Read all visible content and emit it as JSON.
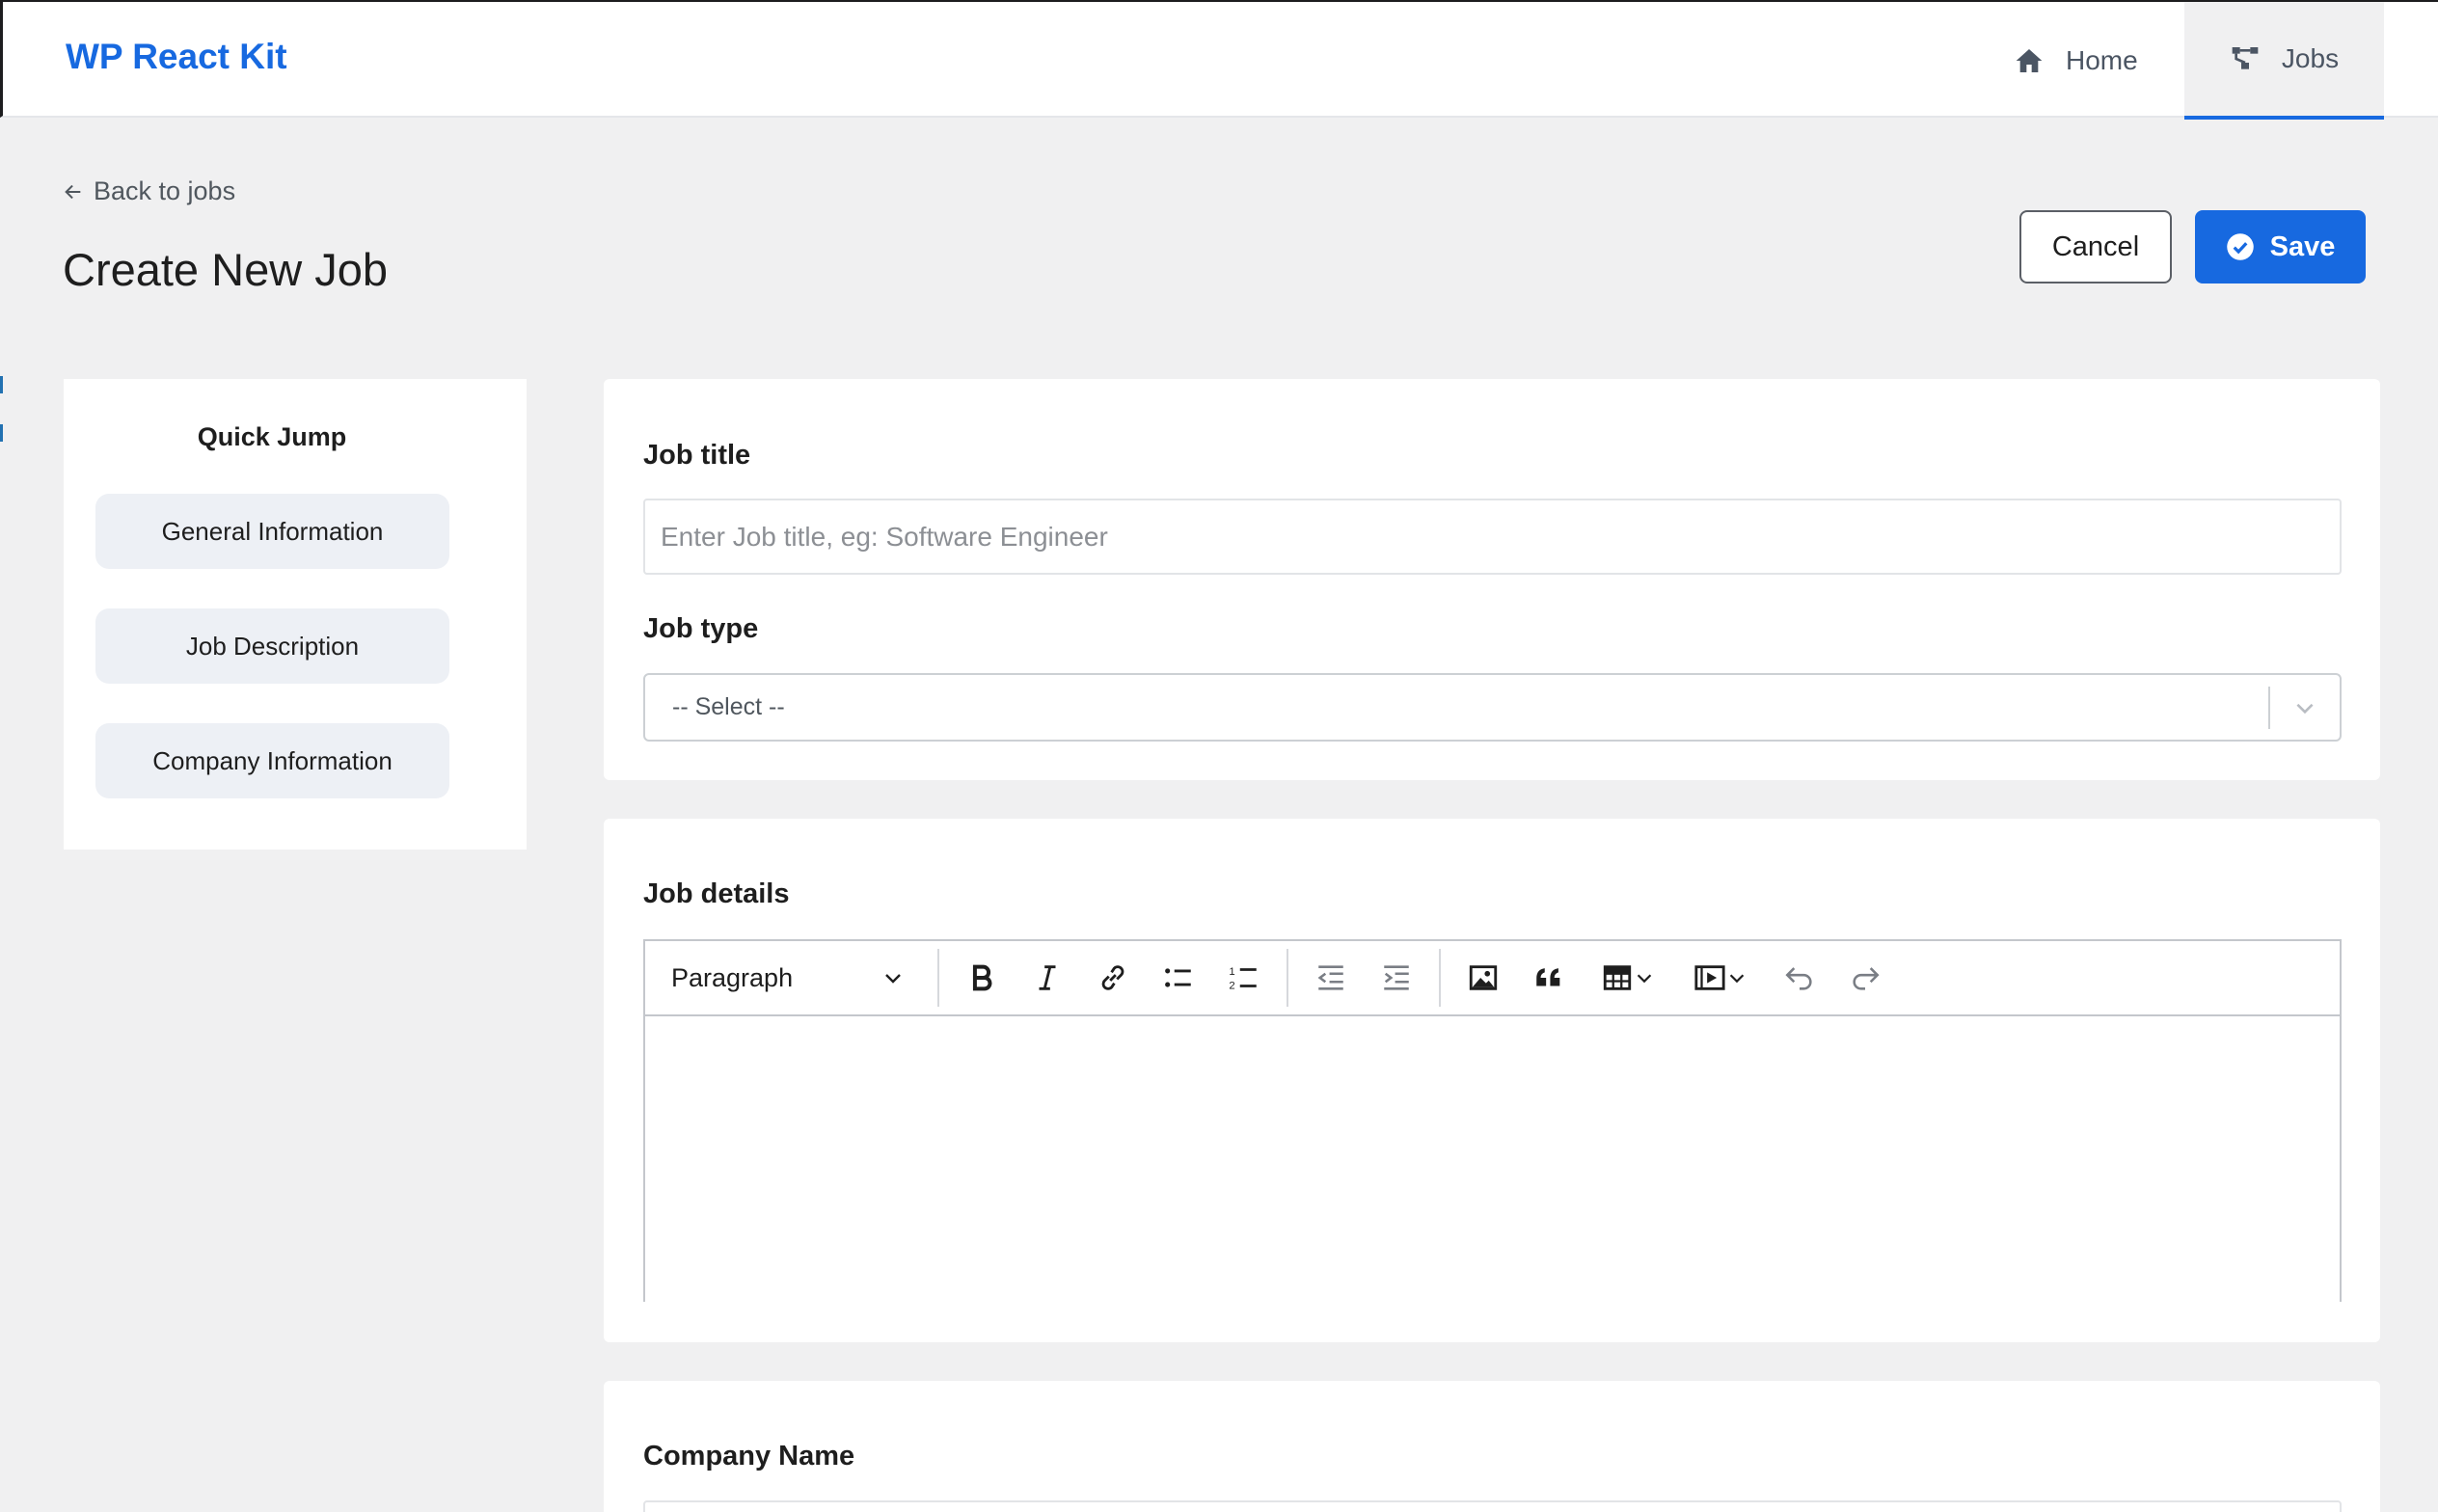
{
  "app": {
    "brand": "WP React Kit"
  },
  "nav": {
    "items": [
      {
        "label": "Home",
        "icon": "home-icon",
        "active": false
      },
      {
        "label": "Jobs",
        "icon": "jobs-icon",
        "active": true
      }
    ]
  },
  "header": {
    "back_label": "Back to jobs",
    "title": "Create New Job",
    "cancel_label": "Cancel",
    "save_label": "Save"
  },
  "quick_jump": {
    "title": "Quick Jump",
    "items": [
      "General Information",
      "Job Description",
      "Company Information"
    ]
  },
  "form": {
    "job_title": {
      "label": "Job title",
      "value": "",
      "placeholder": "Enter Job title, eg: Software Engineer"
    },
    "job_type": {
      "label": "Job type",
      "selected": "-- Select --"
    },
    "job_details": {
      "label": "Job details",
      "block_format": "Paragraph",
      "toolbar_icons": [
        "bold-icon",
        "italic-icon",
        "link-icon",
        "bulleted-list-icon",
        "numbered-list-icon",
        "outdent-icon",
        "indent-icon",
        "image-icon",
        "quote-icon",
        "table-icon",
        "media-icon",
        "undo-icon",
        "redo-icon"
      ],
      "content": ""
    },
    "company_name": {
      "label": "Company Name"
    }
  },
  "colors": {
    "accent": "#1769e0",
    "page_bg": "#f0f0f1",
    "quick_btn_bg": "#edf0f5"
  }
}
